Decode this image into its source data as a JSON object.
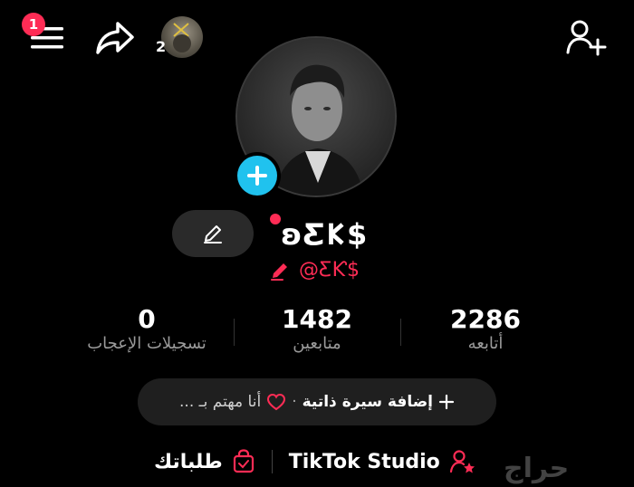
{
  "header": {
    "menu_badge": "1",
    "friend_count": "2"
  },
  "profile": {
    "display_name": "ʚƸ𐌊$",
    "username": "@ƸƘ$"
  },
  "stats": [
    {
      "value": "0",
      "label": "تسجيلات الإعجاب"
    },
    {
      "value": "1482",
      "label": "متابعين"
    },
    {
      "value": "2286",
      "label": "أتابعه"
    }
  ],
  "bio": {
    "add_label": "إضافة سيرة ذاتية",
    "separator": "·",
    "interest_label": "أنا مهتم بـ ..."
  },
  "bottom": {
    "studio_label": "TikTok Studio",
    "orders_label": "طلباتك"
  },
  "watermark": "حراج",
  "colors": {
    "accent_red": "#fe2c55",
    "add_blue": "#20c2ee",
    "background": "#000000"
  },
  "icons": [
    "menu-icon",
    "share-icon",
    "add-friend-icon",
    "pencil-icon",
    "plus-icon",
    "heart-icon",
    "studio-person-icon",
    "shopping-bag-icon"
  ]
}
